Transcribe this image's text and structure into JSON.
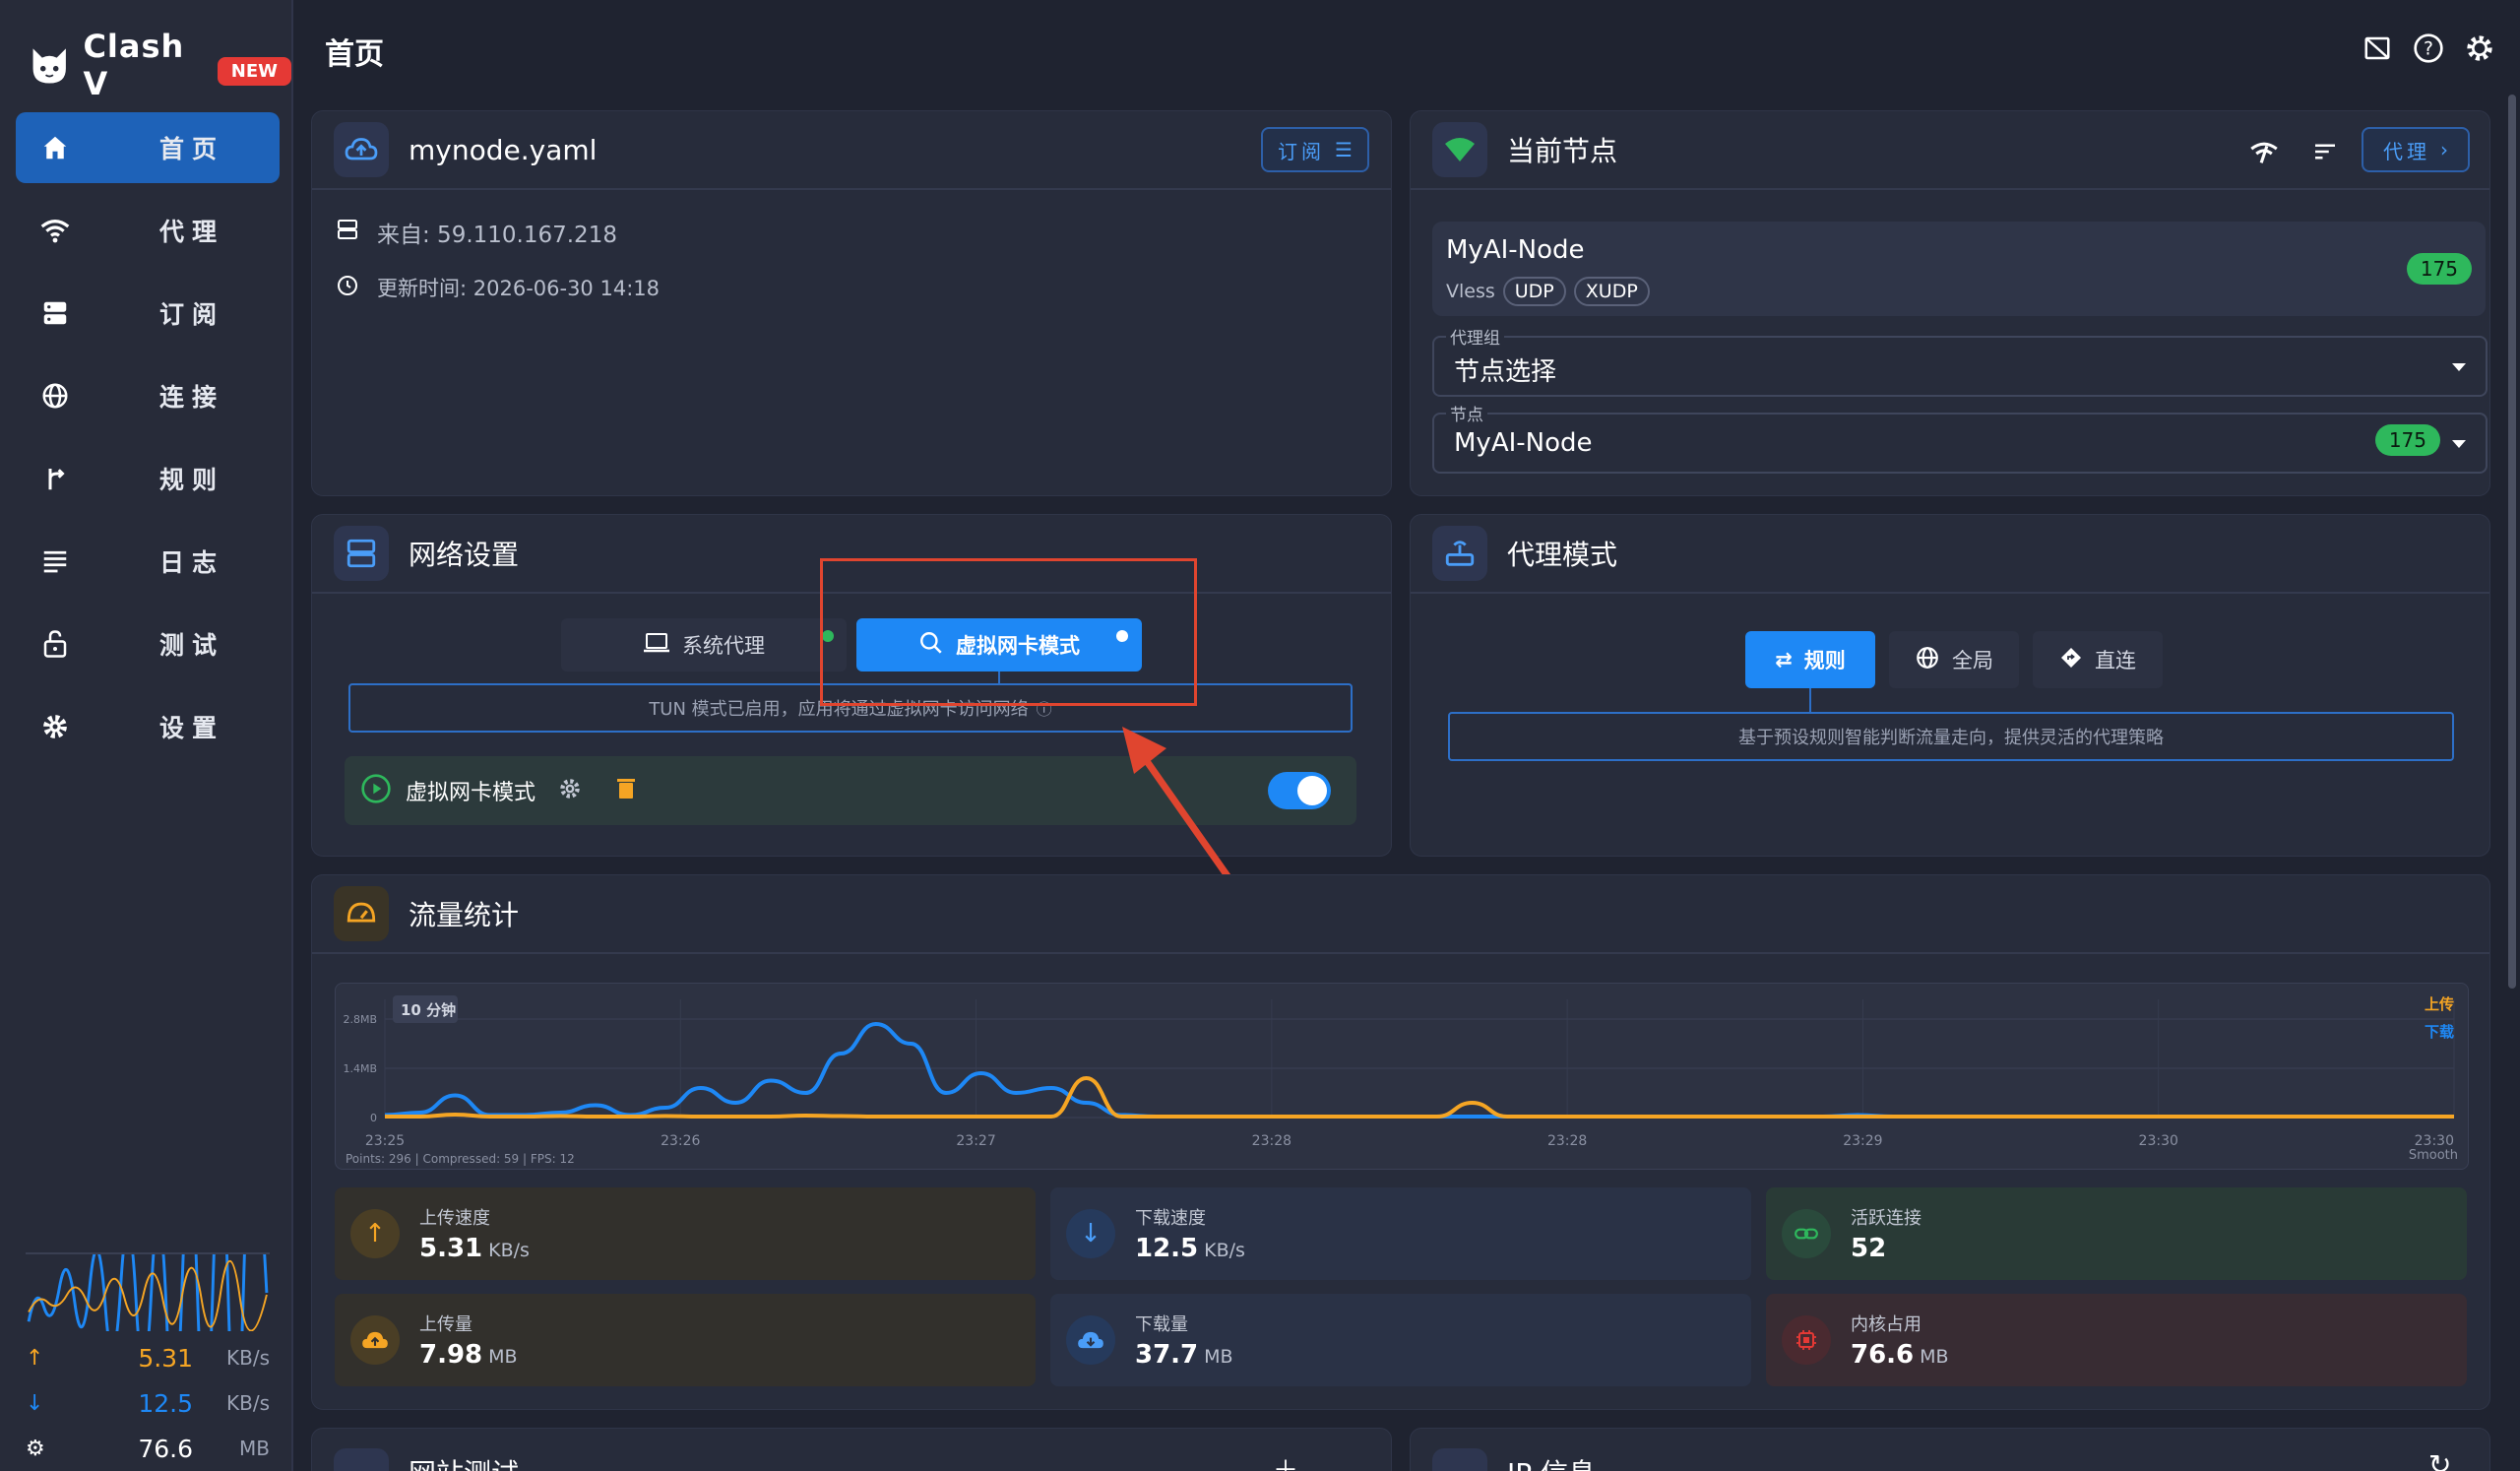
{
  "app": {
    "name": "Clash V",
    "badge": "NEW"
  },
  "sidebar": {
    "items": [
      {
        "label": "首页",
        "icon": "home-icon"
      },
      {
        "label": "代理",
        "icon": "wifi-icon"
      },
      {
        "label": "订阅",
        "icon": "server-icon"
      },
      {
        "label": "连接",
        "icon": "globe-icon"
      },
      {
        "label": "规则",
        "icon": "route-icon"
      },
      {
        "label": "日志",
        "icon": "list-icon"
      },
      {
        "label": "测试",
        "icon": "lock-icon"
      },
      {
        "label": "设置",
        "icon": "gear-icon"
      }
    ],
    "mini_stats": {
      "upload": {
        "value": "5.31",
        "unit": "KB/s"
      },
      "download": {
        "value": "12.5",
        "unit": "KB/s"
      },
      "memory": {
        "value": "76.6",
        "unit": "MB"
      }
    }
  },
  "header": {
    "title": "首页"
  },
  "profile_card": {
    "title": "mynode.yaml",
    "button": "订阅",
    "source": "来自: 59.110.167.218",
    "updated": "更新时间: 2026-06-30 14:18"
  },
  "node_card": {
    "title": "当前节点",
    "button": "代理",
    "node_name": "MyAI-Node",
    "protocol": "Vless",
    "tags": [
      "UDP",
      "XUDP"
    ],
    "latency": "175",
    "group_label": "代理组",
    "group_value": "节点选择",
    "node_label": "节点",
    "node_value": "MyAI-Node",
    "node_latency": "175"
  },
  "network_card": {
    "title": "网络设置",
    "system_proxy": "系统代理",
    "tun_mode": "虚拟网卡模式",
    "hint": "TUN 模式已启用，应用将通过虚拟网卡访问网络",
    "row_label": "虚拟网卡模式",
    "toggle_on": true
  },
  "mode_card": {
    "title": "代理模式",
    "modes": [
      "规则",
      "全局",
      "直连"
    ],
    "active": "规则",
    "hint": "基于预设规则智能判断流量走向，提供灵活的代理策略"
  },
  "traffic_card": {
    "title": "流量统计",
    "range_label": "10 分钟",
    "legend": {
      "upload": "上传",
      "download": "下载"
    },
    "footer_left": "Points: 296 | Compressed: 59 | FPS: 12",
    "footer_right": "Smooth",
    "colors": {
      "upload": "#f5a524",
      "download": "#1e88f5"
    },
    "stats": [
      {
        "label": "上传速度",
        "value": "5.31",
        "unit": "KB/s",
        "icon": "arrow-up-icon"
      },
      {
        "label": "下载速度",
        "value": "12.5",
        "unit": "KB/s",
        "icon": "arrow-down-icon"
      },
      {
        "label": "活跃连接",
        "value": "52",
        "unit": "",
        "icon": "link-icon"
      },
      {
        "label": "上传量",
        "value": "7.98",
        "unit": "MB",
        "icon": "cloud-upload-icon"
      },
      {
        "label": "下载量",
        "value": "37.7",
        "unit": "MB",
        "icon": "cloud-download-icon"
      },
      {
        "label": "内核占用",
        "value": "76.6",
        "unit": "MB",
        "icon": "chip-icon"
      }
    ]
  },
  "bottom_cards": {
    "left_title": "网站测试",
    "right_title": "IP 信息"
  },
  "chart_data": {
    "type": "line",
    "y_ticks": [
      "2.8MB",
      "1.4MB",
      "0"
    ],
    "x_ticks": [
      "23:25",
      "23:26",
      "23:27",
      "23:28",
      "23:28",
      "23:29",
      "23:30",
      "23:30"
    ],
    "series": [
      {
        "name": "上传",
        "values": [
          0.02,
          0.02,
          0.06,
          0.02,
          0.02,
          0.03,
          0.02,
          0.02,
          0.03,
          0.02,
          0.02,
          0.02,
          0.04,
          0.03,
          0.02,
          0.02,
          0.02,
          0.02,
          0.02,
          0.02,
          0.8,
          0.02,
          0.02,
          0.02,
          0.02,
          0.02,
          0.02,
          0.02,
          0.02,
          0.02,
          0.02,
          0.3,
          0.02,
          0.02,
          0.02,
          0.02,
          0.02,
          0.02,
          0.02,
          0.02,
          0.02,
          0.02,
          0.02,
          0.02,
          0.02,
          0.02,
          0.02,
          0.02,
          0.02,
          0.02,
          0.02,
          0.02,
          0.02,
          0.02,
          0.02,
          0.02,
          0.02,
          0.02,
          0.02,
          0.02
        ]
      },
      {
        "name": "下载",
        "values": [
          0.05,
          0.1,
          0.45,
          0.05,
          0.05,
          0.1,
          0.25,
          0.05,
          0.2,
          0.6,
          0.3,
          0.75,
          0.5,
          1.3,
          1.9,
          1.5,
          0.5,
          0.9,
          0.5,
          0.6,
          0.3,
          0.05,
          0.02,
          0.02,
          0.02,
          0.02,
          0.02,
          0.02,
          0.02,
          0.02,
          0.02,
          0.02,
          0.02,
          0.02,
          0.02,
          0.02,
          0.02,
          0.02,
          0.02,
          0.02,
          0.02,
          0.02,
          0.05,
          0.02,
          0.02,
          0.02,
          0.02,
          0.02,
          0.02,
          0.02,
          0.02,
          0.02,
          0.02,
          0.02,
          0.02,
          0.02,
          0.02,
          0.02,
          0.02,
          0.02
        ]
      }
    ]
  }
}
